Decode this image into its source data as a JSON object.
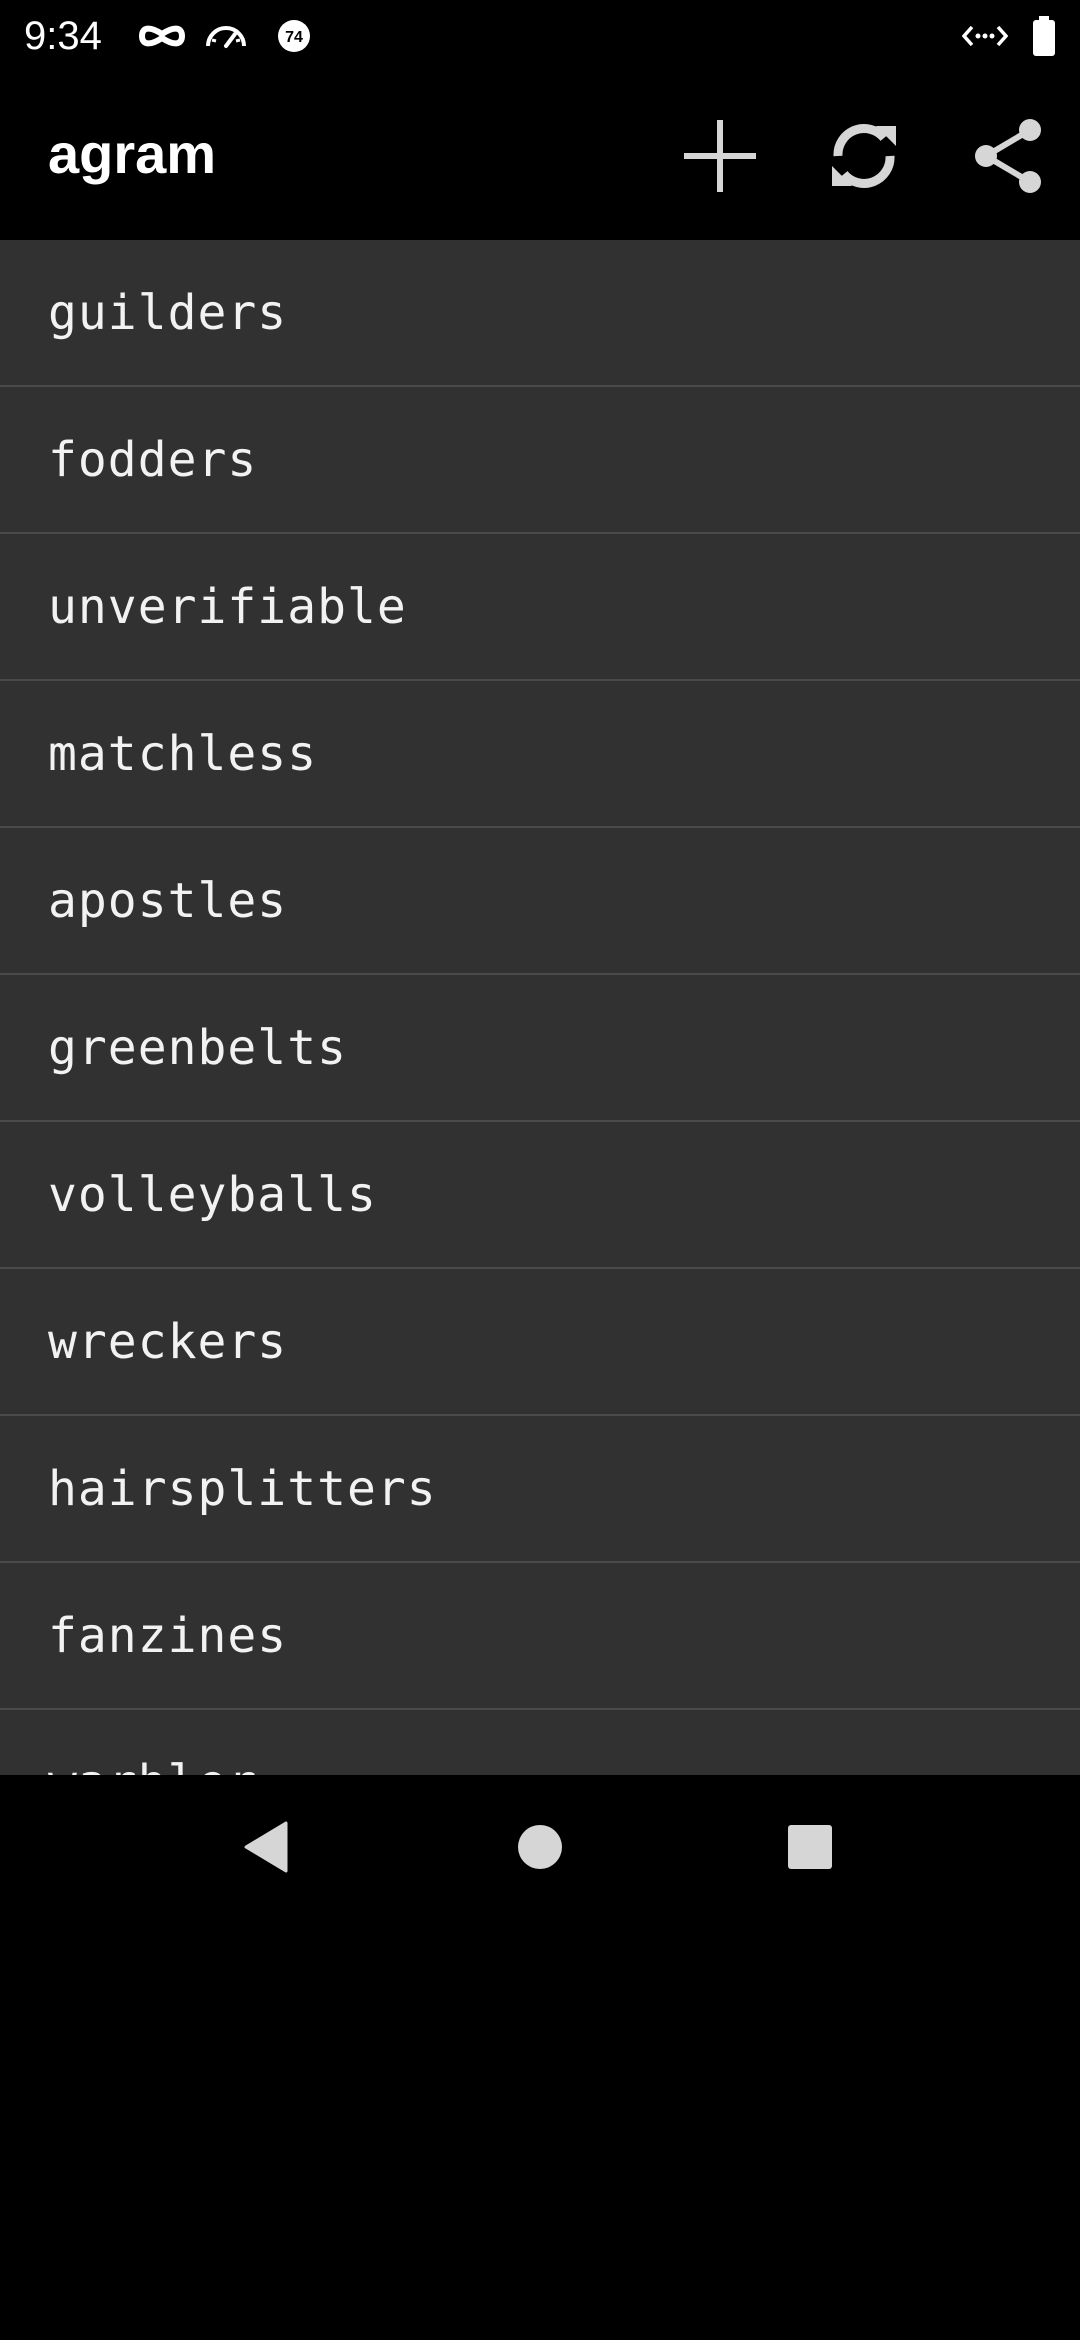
{
  "status_bar": {
    "time": "9:34",
    "icons": [
      "incognito-icon",
      "speedometer-icon",
      "badge-74-icon",
      "data-transfer-icon",
      "battery-icon"
    ],
    "badge_number": "74"
  },
  "app_bar": {
    "title": "agram",
    "actions": [
      "add-icon",
      "refresh-icon",
      "share-icon"
    ]
  },
  "words": [
    "guilders",
    "fodders",
    "unverifiable",
    "matchless",
    "apostles",
    "greenbelts",
    "volleyballs",
    "wreckers",
    "hairsplitters",
    "fanzines",
    "warbler"
  ],
  "nav_bar": {
    "buttons": [
      "back-icon",
      "home-icon",
      "recents-icon"
    ]
  },
  "colors": {
    "background": "#000000",
    "list_background": "#313131",
    "divider": "#4a4a4a",
    "text": "#f2f2f2",
    "icon": "#d6d6d6"
  }
}
